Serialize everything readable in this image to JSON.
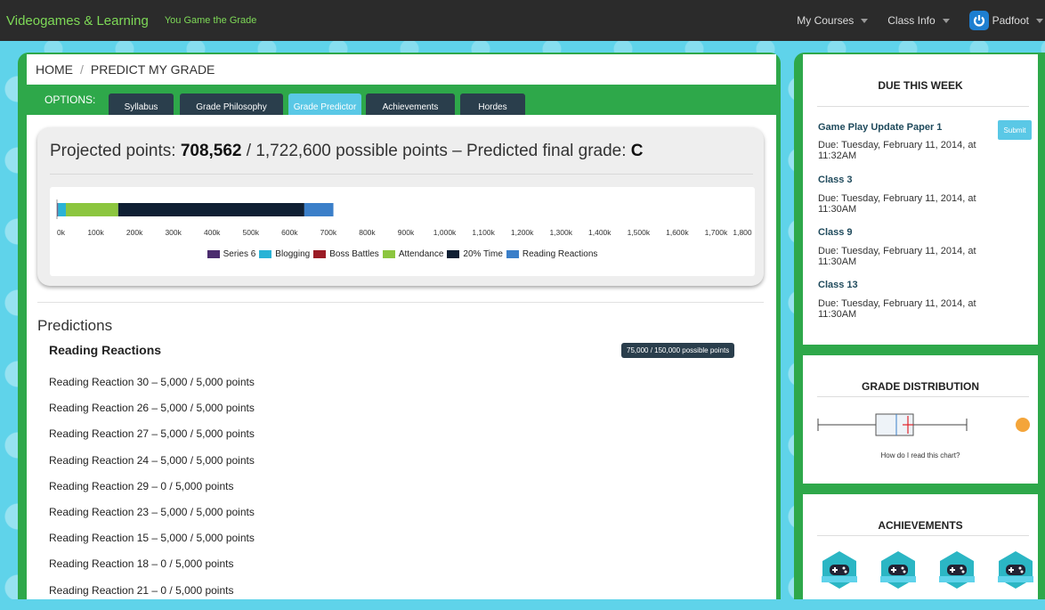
{
  "app": {
    "brand": "Videogames & Learning",
    "tagline": "You Game the Grade"
  },
  "topnav": {
    "my_courses": "My Courses",
    "class_info": "Class Info",
    "user": "Padfoot"
  },
  "breadcrumb": {
    "home": "HOME",
    "separator": "/",
    "current": "PREDICT MY GRADE"
  },
  "options": {
    "label": "OPTIONS:",
    "tabs": [
      {
        "label": "Syllabus",
        "active": false
      },
      {
        "label": "Grade Philosophy",
        "active": false
      },
      {
        "label": "Grade Predictor",
        "active": true
      },
      {
        "label": "Achievements",
        "active": false
      },
      {
        "label": "Hordes",
        "active": false
      }
    ]
  },
  "projected": {
    "prefix": "Projected points: ",
    "points": "708,562",
    "rest": " / 1,722,600 possible points – Predicted final grade: ",
    "grade": "C"
  },
  "chart_data": {
    "type": "bar",
    "orientation": "horizontal-stacked",
    "title": "",
    "xlabel": "",
    "ylabel": "",
    "xlim": [
      0,
      1800000
    ],
    "x_ticks": [
      "0k",
      "100k",
      "200k",
      "300k",
      "400k",
      "500k",
      "600k",
      "700k",
      "800k",
      "900k",
      "1,000k",
      "1,100k",
      "1,200k",
      "1,300k",
      "1,400k",
      "1,500k",
      "1,600k",
      "1,700k",
      "1,800"
    ],
    "series": [
      {
        "name": "Series 6",
        "value": 3000,
        "color": "#4b2c6e"
      },
      {
        "name": "Blogging",
        "value": 20000,
        "color": "#2ab3d6"
      },
      {
        "name": "Boss Battles",
        "value": 0,
        "color": "#9b1b25"
      },
      {
        "name": "Attendance",
        "value": 135000,
        "color": "#8cc63f"
      },
      {
        "name": "20% Time",
        "value": 480000,
        "color": "#0f1f33"
      },
      {
        "name": "Reading Reactions",
        "value": 75000,
        "color": "#3b7fc9"
      }
    ],
    "legend_position": "bottom-center"
  },
  "predictions": {
    "heading": "Predictions",
    "group_title": "Reading Reactions",
    "group_badge": "75,000 / 150,000 possible points",
    "items": [
      "Reading Reaction 30 – 5,000 / 5,000 points",
      "Reading Reaction 26 – 5,000 / 5,000 points",
      "Reading Reaction 27 – 5,000 / 5,000 points",
      "Reading Reaction 24 – 5,000 / 5,000 points",
      "Reading Reaction 29 – 0 / 5,000 points",
      "Reading Reaction 23 – 5,000 / 5,000 points",
      "Reading Reaction 15 – 5,000 / 5,000 points",
      "Reading Reaction 18 – 0 / 5,000 points",
      "Reading Reaction 21 – 0 / 5,000 points"
    ]
  },
  "sidebar": {
    "due": {
      "title": "DUE THIS WEEK",
      "submit_label": "Submit",
      "items": [
        {
          "title": "Game Play Update Paper 1",
          "date": "Due: Tuesday, February 11, 2014, at 11:32AM"
        },
        {
          "title": "Class 3",
          "date": "Due: Tuesday, February 11, 2014, at 11:30AM"
        },
        {
          "title": "Class 9",
          "date": "Due: Tuesday, February 11, 2014, at 11:30AM"
        },
        {
          "title": "Class 13",
          "date": "Due: Tuesday, February 11, 2014, at 11:30AM"
        }
      ]
    },
    "distribution": {
      "title": "GRADE DISTRIBUTION",
      "caption": "How do I read this chart?"
    },
    "achievements": {
      "title": "ACHIEVEMENTS",
      "badge_icons": [
        "gamepad-icon",
        "gamepad-icon",
        "gamepad-icon",
        "gamepad-icon"
      ]
    }
  },
  "colors": {
    "frame_green": "#2ea84a",
    "tab_dark": "#2a3e4c",
    "tab_active": "#5ac8e6",
    "brand_green": "#7ed957"
  }
}
